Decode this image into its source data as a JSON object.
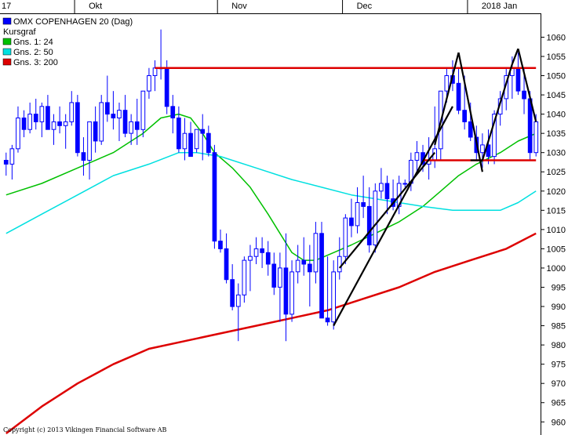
{
  "chart_data": {
    "type": "candlestick",
    "title": "OMX COPENHAGEN 20 (Dag)",
    "xlabel": "",
    "ylabel": "",
    "ylim": [
      957,
      1066
    ],
    "y_ticks": [
      960,
      965,
      970,
      975,
      980,
      985,
      990,
      995,
      1000,
      1005,
      1010,
      1015,
      1020,
      1025,
      1030,
      1035,
      1040,
      1045,
      1050,
      1055,
      1060
    ],
    "months": [
      {
        "label": "17",
        "index": 0
      },
      {
        "label": "Okt",
        "index": 12
      },
      {
        "label": "Nov",
        "index": 36
      },
      {
        "label": "Dec",
        "index": 57
      },
      {
        "label": "2018 Jan",
        "index": 78
      }
    ],
    "legend": [
      {
        "name": "OMX COPENHAGEN 20 (Dag)",
        "color": "#0000ff"
      },
      {
        "name": "Kursgraf",
        "color": ""
      },
      {
        "name": "Gns. 1: 24",
        "color": "#00c000"
      },
      {
        "name": "Gns. 2: 50",
        "color": "#00e0e0"
      },
      {
        "name": "Gns. 3: 200",
        "color": "#dd0000"
      }
    ],
    "copyright": "Copyright (c) 2013 Vikingen Financial Software AB",
    "ohlc": [
      [
        1028,
        1030,
        1024,
        1027
      ],
      [
        1027,
        1032,
        1023,
        1031
      ],
      [
        1031,
        1042,
        1030,
        1039
      ],
      [
        1039,
        1041,
        1034,
        1036
      ],
      [
        1036,
        1043,
        1035,
        1040
      ],
      [
        1040,
        1044,
        1036,
        1038
      ],
      [
        1038,
        1043,
        1034,
        1042
      ],
      [
        1042,
        1045,
        1037,
        1036
      ],
      [
        1036,
        1040,
        1032,
        1038
      ],
      [
        1038,
        1042,
        1035,
        1037
      ],
      [
        1037,
        1040,
        1031,
        1038
      ],
      [
        1038,
        1046,
        1037,
        1043
      ],
      [
        1043,
        1045,
        1029,
        1030
      ],
      [
        1030,
        1034,
        1024,
        1028
      ],
      [
        1028,
        1034,
        1023,
        1038
      ],
      [
        1038,
        1042,
        1030,
        1033
      ],
      [
        1033,
        1045,
        1032,
        1043
      ],
      [
        1043,
        1050,
        1038,
        1040
      ],
      [
        1040,
        1046,
        1036,
        1039
      ],
      [
        1039,
        1043,
        1033,
        1041
      ],
      [
        1041,
        1045,
        1034,
        1035
      ],
      [
        1035,
        1040,
        1032,
        1038
      ],
      [
        1038,
        1044,
        1032,
        1036
      ],
      [
        1036,
        1042,
        1034,
        1046
      ],
      [
        1046,
        1052,
        1044,
        1050
      ],
      [
        1050,
        1054,
        1046,
        1052
      ],
      [
        1052,
        1062,
        1049,
        1052
      ],
      [
        1052,
        1054,
        1040,
        1042
      ],
      [
        1042,
        1045,
        1035,
        1039
      ],
      [
        1039,
        1042,
        1030,
        1031
      ],
      [
        1031,
        1039,
        1028,
        1035
      ],
      [
        1035,
        1038,
        1030,
        1029
      ],
      [
        1031,
        1036,
        1030,
        1036
      ],
      [
        1036,
        1040,
        1028,
        1035
      ],
      [
        1035,
        1037,
        1029,
        1030
      ],
      [
        1030,
        1032,
        1005,
        1007
      ],
      [
        1007,
        1010,
        1004,
        1005
      ],
      [
        1005,
        1009,
        996,
        997
      ],
      [
        997,
        1001,
        989,
        990
      ],
      [
        990,
        996,
        981,
        993
      ],
      [
        993,
        1003,
        991,
        1002
      ],
      [
        1002,
        1006,
        994,
        1003
      ],
      [
        1003,
        1008,
        1001,
        1005
      ],
      [
        1005,
        1008,
        1000,
        1004
      ],
      [
        1004,
        1007,
        998,
        1001
      ],
      [
        1001,
        1004,
        993,
        995
      ],
      [
        995,
        1004,
        986,
        1000
      ],
      [
        1000,
        1009,
        981,
        988
      ],
      [
        988,
        1002,
        986,
        999
      ],
      [
        999,
        1006,
        996,
        1002
      ],
      [
        1002,
        1008,
        998,
        1001
      ],
      [
        1001,
        1006,
        990,
        999
      ],
      [
        999,
        1012,
        996,
        1009
      ],
      [
        1009,
        1012,
        992,
        987
      ],
      [
        987,
        1003,
        985,
        986
      ],
      [
        986,
        1002,
        984,
        999
      ],
      [
        999,
        1008,
        997,
        1003
      ],
      [
        1003,
        1014,
        1001,
        1013
      ],
      [
        1013,
        1018,
        1008,
        1011
      ],
      [
        1011,
        1021,
        1009,
        1017
      ],
      [
        1017,
        1024,
        1013,
        1016
      ],
      [
        1016,
        1021,
        1004,
        1006
      ],
      [
        1006,
        1022,
        1004,
        1020
      ],
      [
        1020,
        1026,
        1018,
        1022
      ],
      [
        1022,
        1024,
        1014,
        1018
      ],
      [
        1018,
        1023,
        1015,
        1016
      ],
      [
        1016,
        1024,
        1014,
        1022
      ],
      [
        1022,
        1023,
        1021,
        1022
      ],
      [
        1022,
        1030,
        1020,
        1028
      ],
      [
        1028,
        1033,
        1025,
        1030
      ],
      [
        1030,
        1032,
        1025,
        1027
      ],
      [
        1027,
        1034,
        1023,
        1028
      ],
      [
        1028,
        1042,
        1026,
        1031
      ],
      [
        1031,
        1045,
        1028,
        1046
      ],
      [
        1046,
        1052,
        1043,
        1050
      ],
      [
        1050,
        1054,
        1046,
        1048
      ],
      [
        1048,
        1052,
        1040,
        1041
      ],
      [
        1041,
        1050,
        1036,
        1038
      ],
      [
        1038,
        1043,
        1033,
        1034
      ],
      [
        1034,
        1037,
        1028,
        1030
      ],
      [
        1030,
        1035,
        1026,
        1032
      ],
      [
        1032,
        1036,
        1027,
        1029
      ],
      [
        1029,
        1041,
        1027,
        1040
      ],
      [
        1040,
        1046,
        1037,
        1044
      ],
      [
        1044,
        1052,
        1041,
        1050
      ],
      [
        1050,
        1055,
        1044,
        1052
      ],
      [
        1052,
        1056,
        1045,
        1046
      ],
      [
        1046,
        1052,
        1040,
        1044
      ],
      [
        1044,
        1046,
        1028,
        1030
      ],
      [
        1030,
        1040,
        1029,
        1038
      ]
    ],
    "series": [
      {
        "name": "Gns. 1: 24",
        "color": "#00c000",
        "width": 1.5,
        "values": [
          [
            0,
            1019
          ],
          [
            6,
            1022
          ],
          [
            12,
            1026
          ],
          [
            18,
            1030
          ],
          [
            23,
            1035
          ],
          [
            26,
            1039
          ],
          [
            29,
            1040
          ],
          [
            31,
            1039
          ],
          [
            33,
            1035
          ],
          [
            35,
            1030
          ],
          [
            38,
            1026
          ],
          [
            41,
            1021
          ],
          [
            44,
            1014
          ],
          [
            46,
            1009
          ],
          [
            48,
            1004
          ],
          [
            50,
            1002
          ],
          [
            52,
            1002
          ],
          [
            55,
            1004
          ],
          [
            58,
            1006
          ],
          [
            62,
            1009
          ],
          [
            66,
            1012
          ],
          [
            70,
            1016
          ],
          [
            73,
            1020
          ],
          [
            76,
            1024
          ],
          [
            79,
            1027
          ],
          [
            83,
            1030
          ],
          [
            86,
            1033
          ],
          [
            89,
            1035
          ]
        ]
      },
      {
        "name": "Gns. 2: 50",
        "color": "#00e0e0",
        "width": 1.5,
        "values": [
          [
            0,
            1009
          ],
          [
            6,
            1014
          ],
          [
            12,
            1019
          ],
          [
            18,
            1024
          ],
          [
            24,
            1027
          ],
          [
            29,
            1030
          ],
          [
            32,
            1030
          ],
          [
            36,
            1029
          ],
          [
            42,
            1026
          ],
          [
            48,
            1023
          ],
          [
            53,
            1021
          ],
          [
            58,
            1019
          ],
          [
            62,
            1018
          ],
          [
            66,
            1017
          ],
          [
            70,
            1016
          ],
          [
            75,
            1015
          ],
          [
            80,
            1015
          ],
          [
            83,
            1015
          ],
          [
            86,
            1017
          ],
          [
            89,
            1020
          ]
        ]
      },
      {
        "name": "Gns. 3: 200",
        "color": "#dd0000",
        "width": 2.5,
        "values": [
          [
            0,
            957
          ],
          [
            6,
            964
          ],
          [
            12,
            970
          ],
          [
            18,
            975
          ],
          [
            24,
            979
          ],
          [
            30,
            981
          ],
          [
            36,
            983
          ],
          [
            42,
            985
          ],
          [
            48,
            987
          ],
          [
            54,
            989
          ],
          [
            60,
            992
          ],
          [
            66,
            995
          ],
          [
            72,
            999
          ],
          [
            78,
            1002
          ],
          [
            84,
            1005
          ],
          [
            89,
            1009
          ]
        ]
      }
    ],
    "annotations": {
      "h_lines": [
        {
          "y": 1052,
          "x0": 25,
          "x1": 89,
          "color": "#dd0000"
        },
        {
          "y": 1028,
          "x0": 70,
          "x1": 89,
          "color": "#dd0000"
        }
      ],
      "trend_lines": [
        [
          [
            55,
            985
          ],
          [
            75,
            1042
          ]
        ],
        [
          [
            56,
            1000
          ],
          [
            72,
            1030
          ]
        ],
        [
          [
            72,
            1032
          ],
          [
            76,
            1056
          ]
        ],
        [
          [
            76,
            1056
          ],
          [
            80,
            1025
          ]
        ],
        [
          [
            78,
            1028
          ],
          [
            80,
            1028
          ]
        ],
        [
          [
            80,
            1028
          ],
          [
            85,
            1053
          ]
        ],
        [
          [
            85,
            1053
          ],
          [
            86,
            1057
          ]
        ],
        [
          [
            86,
            1057
          ],
          [
            89,
            1038
          ]
        ]
      ]
    }
  }
}
